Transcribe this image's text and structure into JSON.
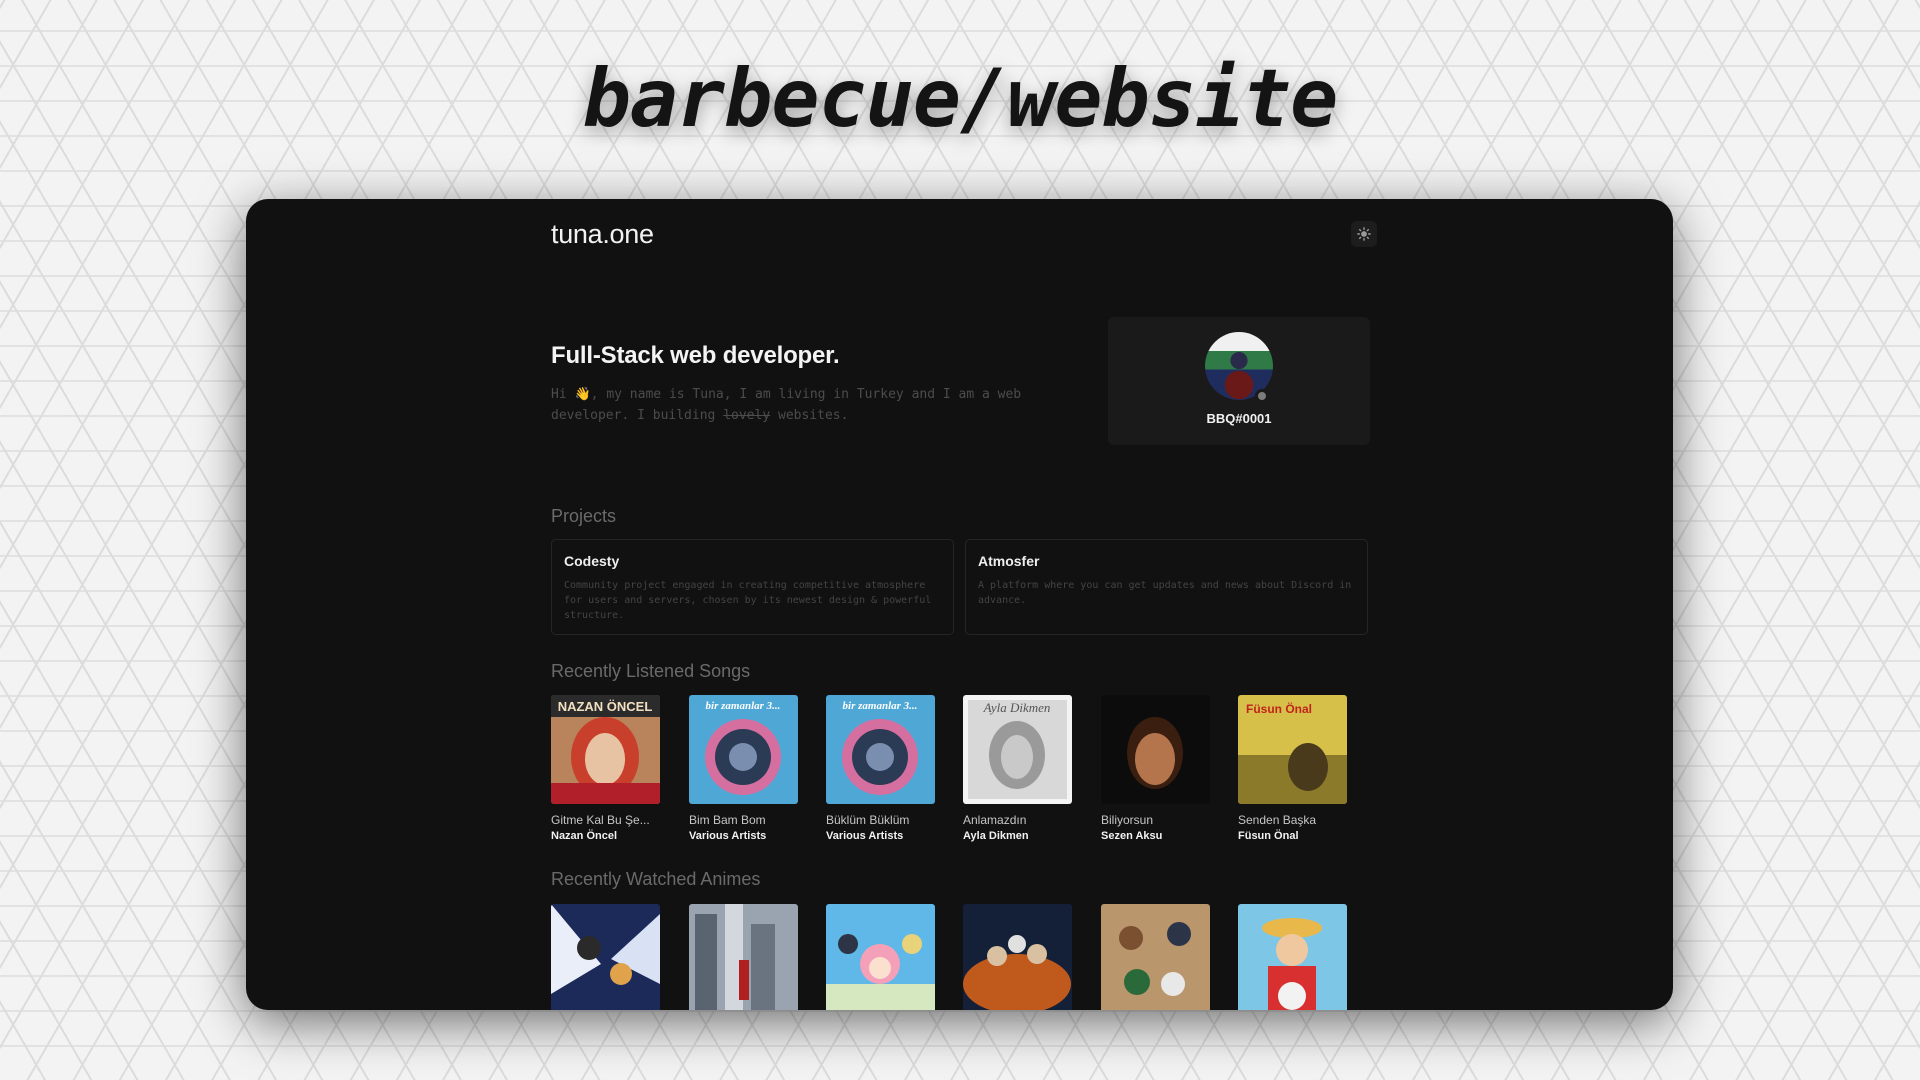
{
  "banner": {
    "title": "barbecue/website"
  },
  "site": {
    "logo": "tuna.one"
  },
  "hero": {
    "title": "Full-Stack web developer.",
    "intro_hi": "Hi",
    "intro_wave": "👋",
    "intro_rest": ", my name is Tuna, I am living in Turkey and I am a web developer. I building",
    "intro_strike": "lovely",
    "intro_end": "websites."
  },
  "discord": {
    "username": "BBQ#0001",
    "status_color": "#7c7c7c"
  },
  "sections": {
    "projects": "Projects",
    "songs": "Recently Listened Songs",
    "animes": "Recently Watched Animes"
  },
  "projects": [
    {
      "name": "Codesty",
      "description": "Community project engaged in creating competitive atmosphere for users and servers, chosen by its newest design & powerful structure."
    },
    {
      "name": "Atmosfer",
      "description": "A platform where you can get updates and news about Discord in advance."
    }
  ],
  "songs": [
    {
      "title": "Gitme Kal Bu Şe...",
      "artist": "Nazan Öncel",
      "cover_title": "NAZAN ÖNCEL"
    },
    {
      "title": "Bim Bam Bom",
      "artist": "Various Artists",
      "cover_title": "bir zamanlar 3..."
    },
    {
      "title": "Büklüm Büklüm",
      "artist": "Various Artists",
      "cover_title": "bir zamanlar 3..."
    },
    {
      "title": "Anlamazdın",
      "artist": "Ayla Dikmen",
      "cover_title": "Ayla Dikmen"
    },
    {
      "title": "Biliyorsun",
      "artist": "Sezen Aksu",
      "cover_title": ""
    },
    {
      "title": "Senden Başka",
      "artist": "Füsun Önal",
      "cover_title": "Füsun Önal"
    }
  ],
  "colors": {
    "background": "#111111",
    "card": "#1a1a1a",
    "muted_text": "#6a6a6a"
  },
  "icons": {
    "theme_toggle": "sun-icon"
  }
}
